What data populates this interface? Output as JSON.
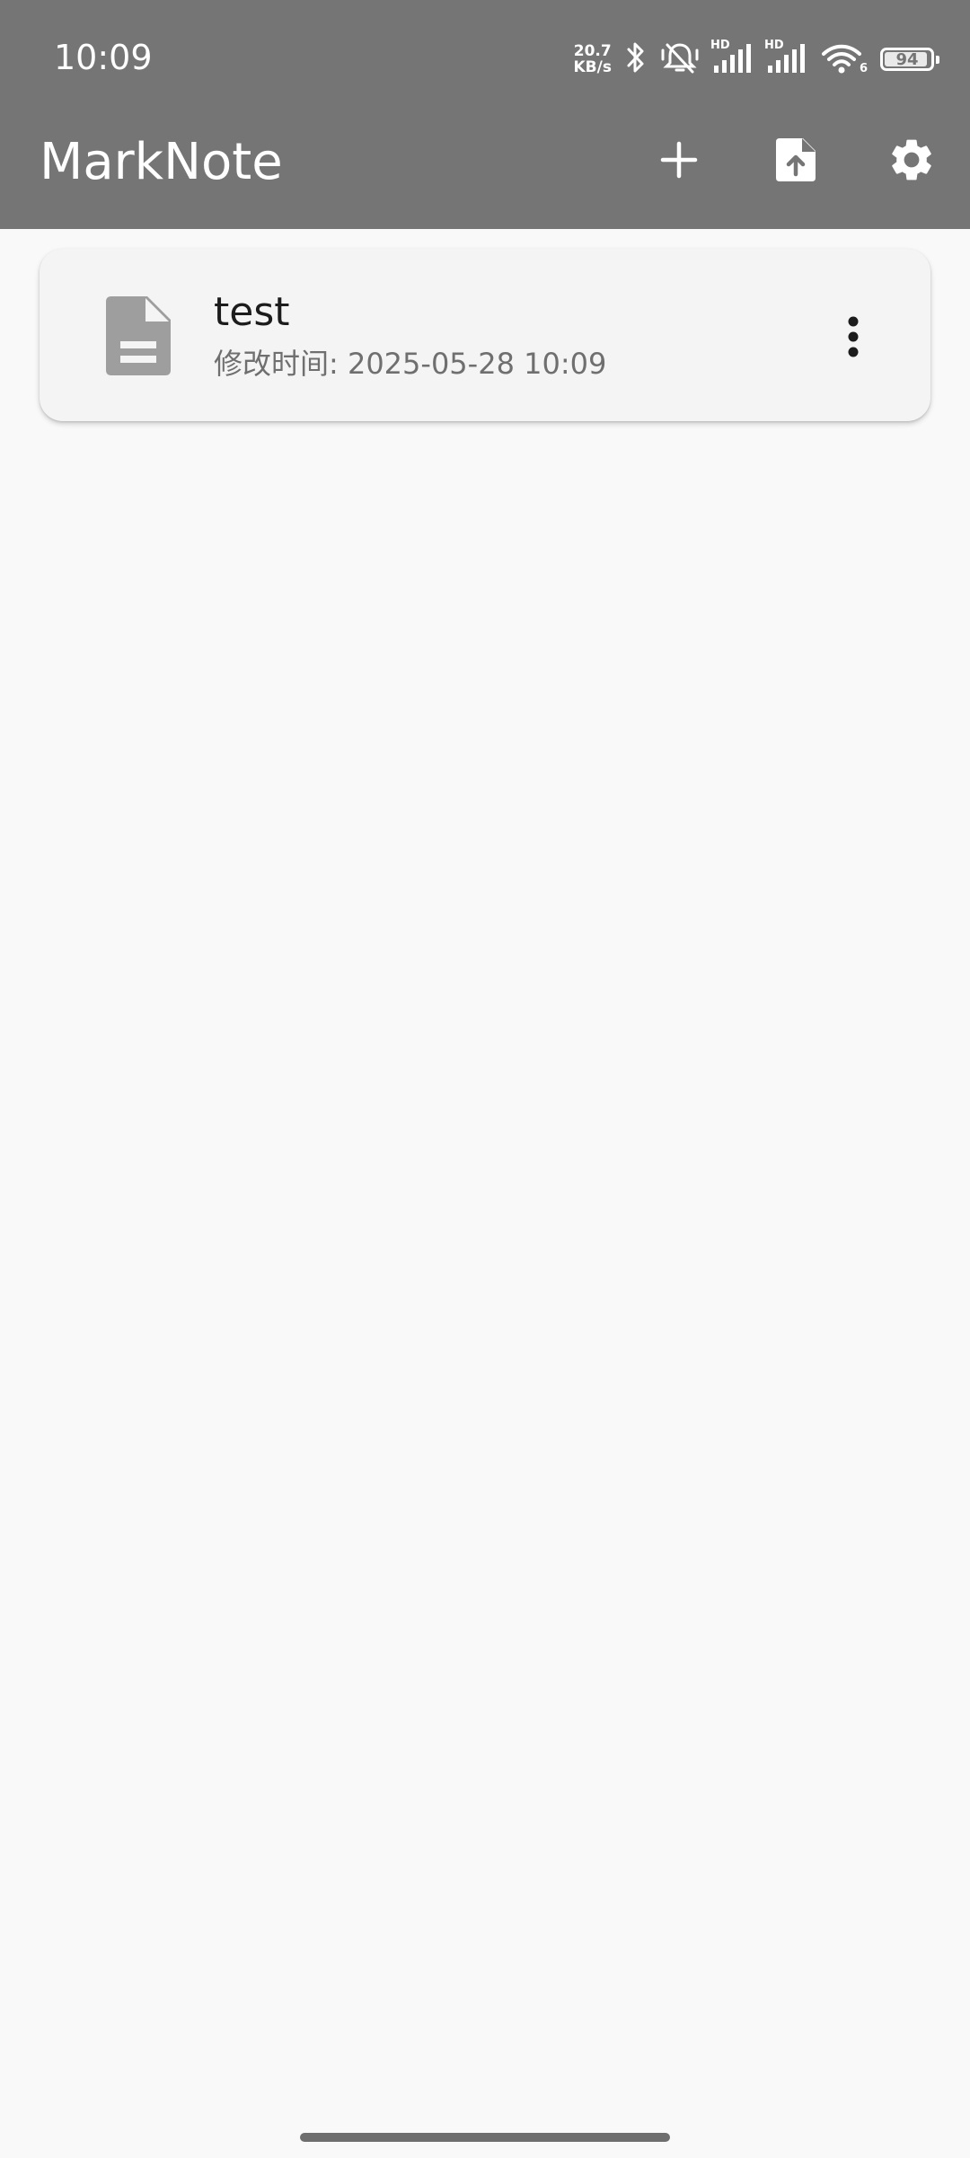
{
  "status_bar": {
    "time": "10:09",
    "net_speed_value": "20.7",
    "net_speed_unit": "KB/s",
    "signal1_label": "HD",
    "signal2_label": "HD",
    "wifi_label": "6",
    "battery_level": "94",
    "battery_fraction": 0.94,
    "icons": [
      "bluetooth-icon",
      "muted-bell-icon",
      "cell-signal-icon",
      "cell-signal-icon",
      "wifi-icon",
      "battery-icon"
    ]
  },
  "app_bar": {
    "title": "MarkNote",
    "actions": [
      "add-icon",
      "file-upload-icon",
      "settings-icon"
    ]
  },
  "notes": [
    {
      "title": "test",
      "modified": "修改时间: 2025-05-28 10:09",
      "icon": "document-icon",
      "menu_icon": "more-vert-icon"
    }
  ],
  "colors": {
    "app_bar": "#757575",
    "background": "#f9f9f9",
    "card": "#f4f4f4",
    "doc_icon": "#9e9e9e"
  }
}
